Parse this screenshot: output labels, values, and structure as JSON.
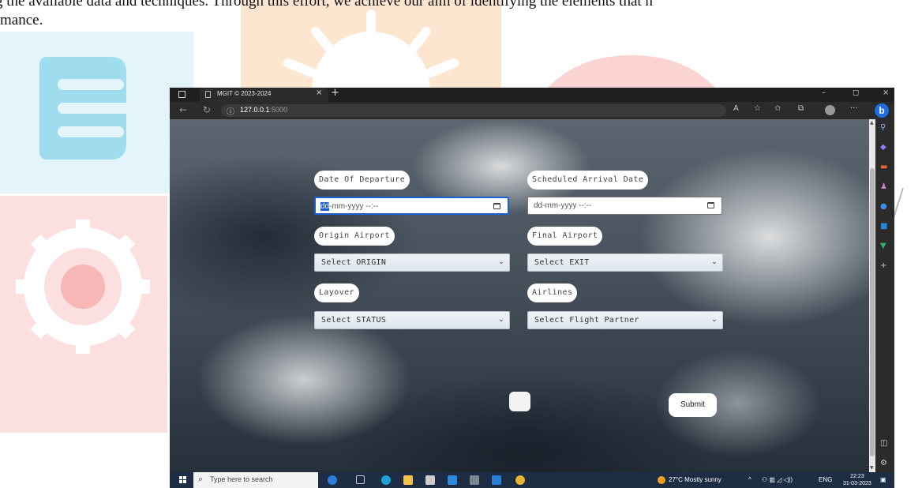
{
  "document": {
    "line1": "g the available data and techniques. Through this effort, we achieve our aim of identifying the elements that h",
    "line2": "mance."
  },
  "browser": {
    "tab_title": "MGIT © 2023-2024",
    "tab_close": "×",
    "new_tab": "+",
    "url_host": "127.0.0.1",
    "url_port": ":5000",
    "window_min": "–",
    "window_max": "◻",
    "window_close": "×"
  },
  "form": {
    "date_of_departure_label": "Date Of Departure",
    "date_of_departure_highlight": "dd",
    "date_of_departure_rest": "-mm-yyyy --:--",
    "scheduled_arrival_label": "Scheduled Arrival Date",
    "scheduled_arrival_value": "dd-mm-yyyy --:--",
    "origin_label": "Origin Airport",
    "origin_value": "Select ORIGIN",
    "final_label": "Final Airport",
    "final_value": "Select EXIT",
    "layover_label": "Layover",
    "layover_value": "Select STATUS",
    "airlines_label": "Airlines",
    "airlines_value": "Select Flight Partner",
    "submit_label": "Submit"
  },
  "taskbar": {
    "search_placeholder": "Type here to search",
    "weather": "27°C  Mostly sunny",
    "lang": "ENG",
    "time": "22:23",
    "date": "31-03-2023"
  },
  "colors": {
    "focus_blue": "#1a5fd6",
    "bing_blue": "#1f6fe0",
    "taskbar": "#1c2d44"
  }
}
